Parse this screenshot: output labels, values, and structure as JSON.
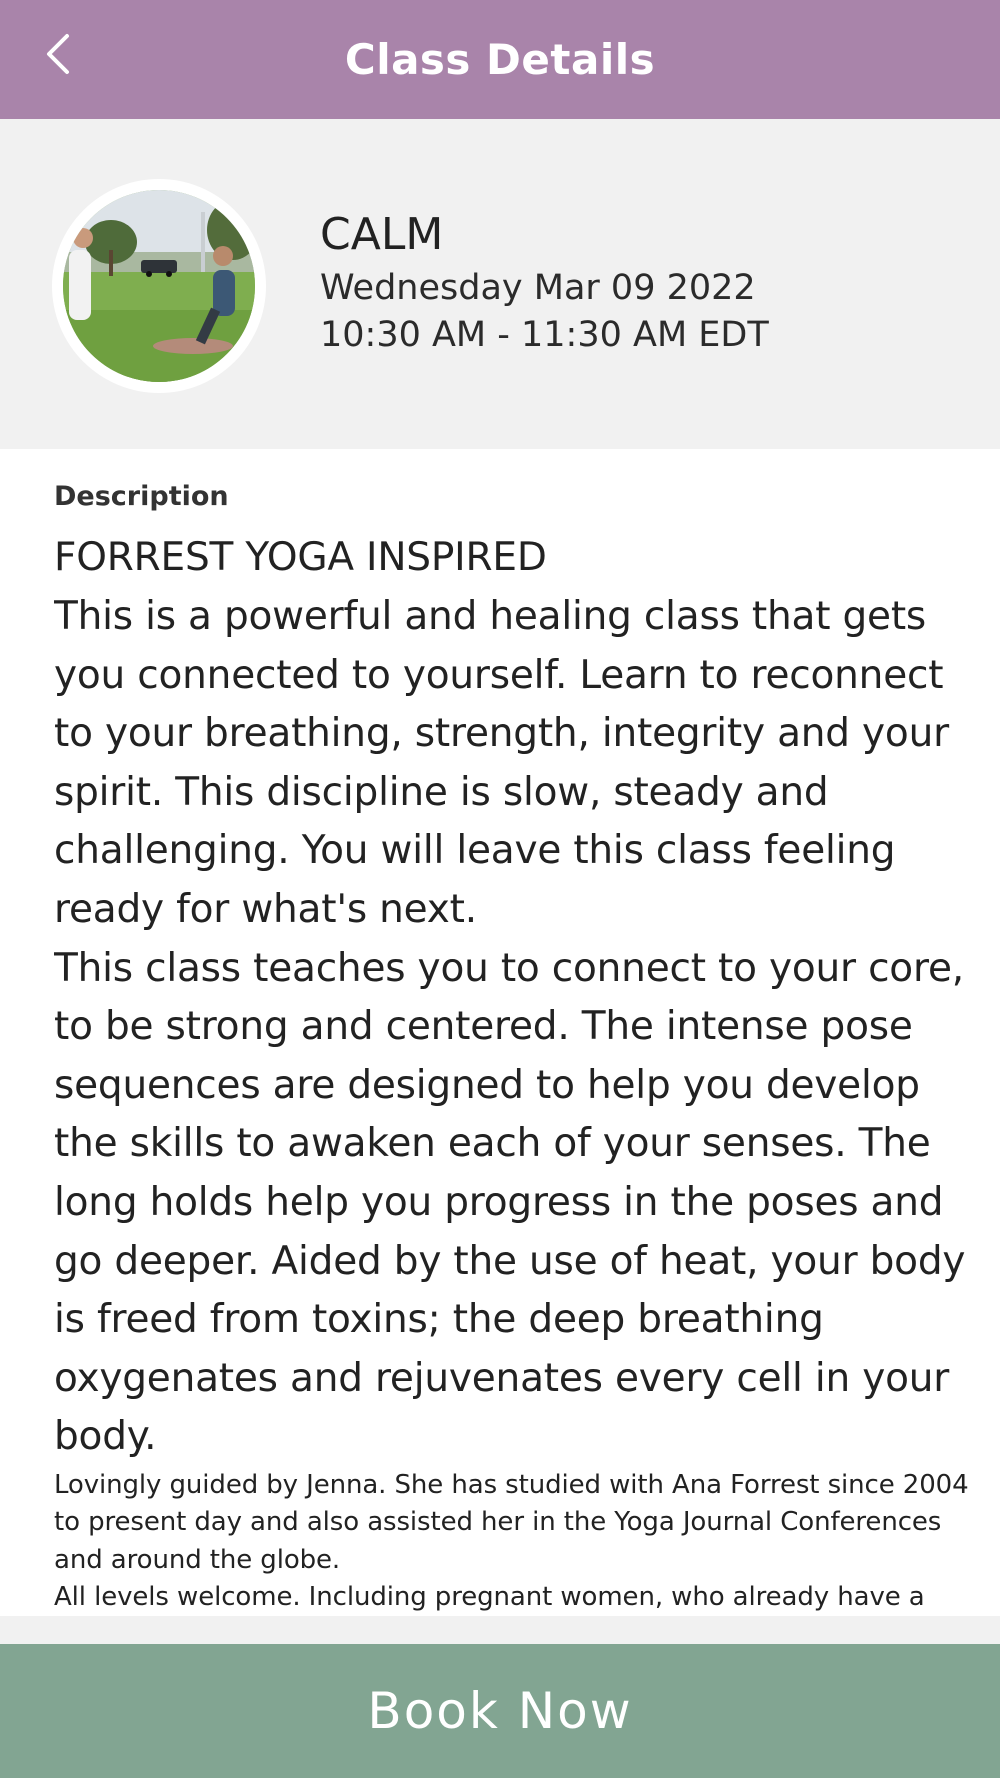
{
  "header": {
    "title": "Class Details",
    "back_icon": "chevron-left-icon",
    "background_color": "#a984aa"
  },
  "class": {
    "name": "CALM",
    "date": "Wednesday Mar 09 2022",
    "time": "10:30 AM - 11:30 AM EDT"
  },
  "description": {
    "label": "Description",
    "heading": "FORREST YOGA INSPIRED",
    "paragraph_1": "This is a powerful and healing class that gets you connected to yourself. Learn to reconnect to your breathing, strength, integrity and your spirit. This discipline is slow, steady and challenging. You will leave this class feeling ready for what's next.",
    "paragraph_2": "This class teaches you to connect to your core, to be strong and centered. The intense pose sequences are designed to help you develop the skills to awaken each of your senses. The long holds help you progress in the poses and go deeper. Aided by the use of heat, your body is freed from toxins; the deep breathing oxygenates and rejuvenates every cell in your body.",
    "paragraph_3": "Lovingly guided by Jenna. She has studied with Ana Forrest since 2004 to present day and also assisted her in the Yoga Journal Conferences and around the globe.",
    "paragraph_4": "All levels welcome. Including pregnant women, who already have a"
  },
  "footer": {
    "book_label": "Book Now",
    "background_color": "#82a592"
  }
}
